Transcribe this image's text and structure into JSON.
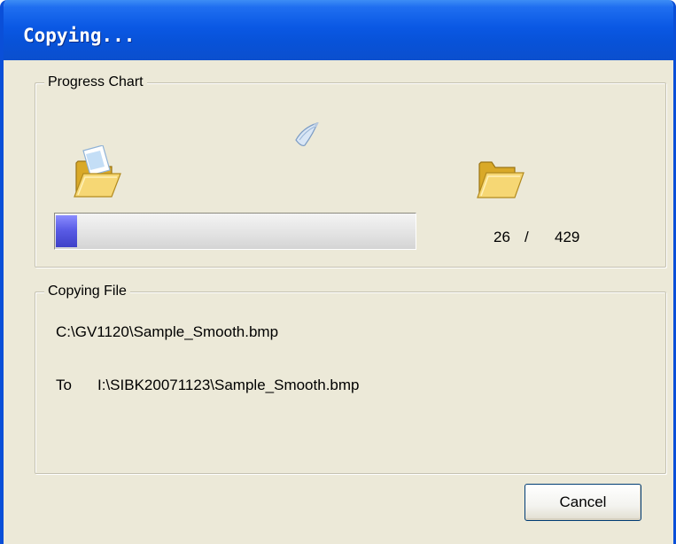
{
  "window": {
    "title": "Copying..."
  },
  "progress_group": {
    "label": "Progress Chart",
    "current": "26",
    "separator": "/",
    "total": "429",
    "fraction_complete": 0.06,
    "source_folder_icon": "open-folder-with-document-icon",
    "flying_document_icon": "flying-document-icon",
    "destination_folder_icon": "open-folder-icon",
    "bar_color": "#5a5ce6"
  },
  "copy_group": {
    "label": "Copying File",
    "source_path": "C:\\GV1120\\Sample_Smooth.bmp",
    "to_label": "To",
    "destination_path": "I:\\SIBK20071123\\Sample_Smooth.bmp"
  },
  "buttons": {
    "cancel_label": "Cancel"
  },
  "colors": {
    "titlebar": "#0a58e4",
    "dialog_background": "#ece9d8"
  }
}
